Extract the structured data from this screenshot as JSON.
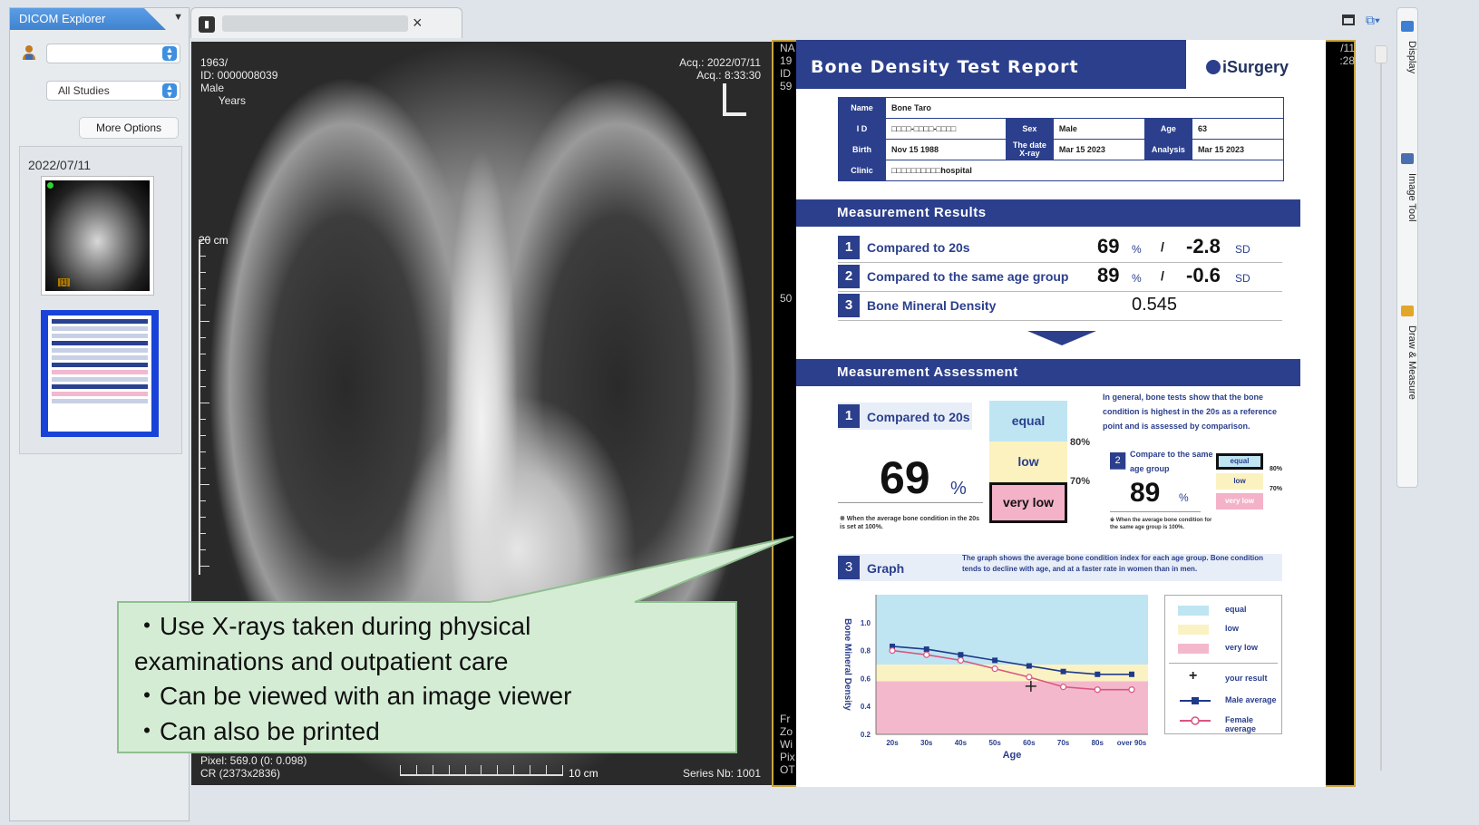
{
  "left_panel": {
    "tab_label": "DICOM Explorer",
    "menu_glyph": "▼",
    "patient_select": "",
    "studies_select": "All Studies",
    "more_options": "More Options",
    "series_date": "2022/07/11",
    "thumb1_badge": "[1]"
  },
  "toolbar": {
    "close_glyph": "×"
  },
  "xray": {
    "top_left": [
      "1963/",
      "ID: 0000008039",
      "Male",
      "      Years"
    ],
    "top_right": [
      "Acq.: 2022/07/11",
      "Acq.: 8:33:30"
    ],
    "ruler_label": "20 cm",
    "bottom_left": [
      "Pixel: 569.0 (0: 0.098)",
      "CR (2373x2836)"
    ],
    "scale_label": "10 cm",
    "series_label": "Series Nb: 1001"
  },
  "report_viewport": {
    "left_edge": [
      "NA",
      "19",
      "ID",
      "59"
    ],
    "left_edge_mid": "50",
    "left_edge_bottom": [
      "Fr",
      "Zo",
      "Wi",
      "Pix",
      "OT"
    ],
    "right_edge": [
      "/11",
      ":28"
    ]
  },
  "report": {
    "title": "Bone Density Test Report",
    "logo": "iSurgery",
    "info": {
      "name_h": "Name",
      "name": "Bone Taro",
      "id_h": "I D",
      "id": "□□□□-□□□□-□□□□",
      "sex_h": "Sex",
      "sex": "Male",
      "age_h": "Age",
      "age": "63",
      "birth_h": "Birth",
      "birth": "Nov 15 1988",
      "xray_h": "The date X-ray",
      "xray": "Mar 15 2023",
      "analysis_h": "Analysis",
      "analysis": "Mar 15 2023",
      "clinic_h": "Clinic",
      "clinic": "□□□□□□□□□□hospital"
    },
    "results_title": "Measurement Results",
    "results": [
      {
        "num": "1",
        "label": "Compared to 20s",
        "v1": "69",
        "u1": "%",
        "sep": "/",
        "v2": "-2.8",
        "u2": "SD"
      },
      {
        "num": "2",
        "label": "Compared to the same age group",
        "v1": "89",
        "u1": "%",
        "sep": "/",
        "v2": "-0.6",
        "u2": "SD"
      },
      {
        "num": "3",
        "label": "Bone Mineral Density",
        "v1": "0.545"
      }
    ],
    "assessment_title": "Measurement Assessment",
    "a1": {
      "num": "1",
      "label": "Compared to 20s",
      "value": "69",
      "unit": "%",
      "note": "※ When the average bone condition in the 20s is set at 100%.",
      "levels": [
        "equal",
        "low",
        "very low"
      ],
      "t80": "80%",
      "t70": "70%"
    },
    "explanation": "In general, bone tests show that the bone condition is highest in the 20s as a reference point and is assessed by comparison.",
    "a2": {
      "num": "2",
      "label": "Compare to the same age group",
      "value": "89",
      "unit": "%",
      "note": "※ When the average bone condition for the same age group is 100%.",
      "levels": [
        "equal",
        "low",
        "very low"
      ],
      "t80": "80%",
      "t70": "70%"
    },
    "graph": {
      "num": "3",
      "label": "Graph",
      "desc": "The graph shows the average bone condition index for each age group. Bone condition tends to decline with age, and at a faster rate in women than in men.",
      "legend": [
        "equal",
        "low",
        "very low",
        "your result",
        "Male average",
        "Female average"
      ]
    }
  },
  "chart_data": {
    "type": "line",
    "title": "",
    "xlabel": "Age",
    "ylabel": "Bone Mineral Density",
    "categories": [
      "20s",
      "30s",
      "40s",
      "50s",
      "60s",
      "70s",
      "80s",
      "over 90s"
    ],
    "ylim": [
      0.2,
      1.2
    ],
    "yticks": [
      0.2,
      0.4,
      0.6,
      0.8,
      1.0
    ],
    "bands": [
      {
        "name": "very low",
        "from": 0.2,
        "to": 0.58,
        "color": "#f4b8cc"
      },
      {
        "name": "low",
        "from": 0.58,
        "to": 0.7,
        "color": "#fbf2c4"
      },
      {
        "name": "equal",
        "from": 0.7,
        "to": 1.2,
        "color": "#bfe4f2"
      }
    ],
    "series": [
      {
        "name": "Male average",
        "values": [
          0.83,
          0.81,
          0.77,
          0.73,
          0.69,
          0.65,
          0.63,
          0.63
        ],
        "color": "#1e3a8a",
        "marker": "square"
      },
      {
        "name": "Female average",
        "values": [
          0.8,
          0.77,
          0.73,
          0.67,
          0.61,
          0.54,
          0.52,
          0.52
        ],
        "color": "#d9567f",
        "marker": "circle"
      }
    ],
    "your_result": {
      "x": "60s",
      "y": 0.545
    }
  },
  "callout": {
    "text": "・Use X-rays taken during physical\nexaminations and outpatient care\n・Can be viewed with an image viewer\n・Can also be printed"
  },
  "right_sidebar": {
    "tools": [
      "Display",
      "Image Tool",
      "Draw & Measure"
    ]
  }
}
